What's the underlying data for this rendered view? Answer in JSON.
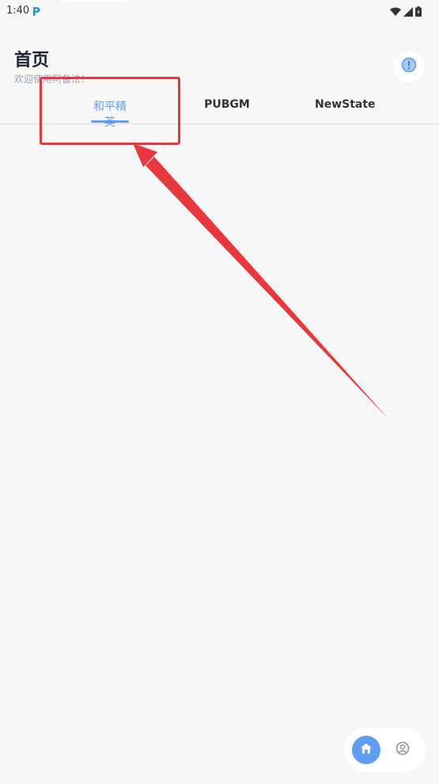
{
  "status_bar": {
    "time": "1:40",
    "icons": [
      "app-notification-icon",
      "wifi-icon",
      "signal-icon",
      "battery-icon"
    ]
  },
  "header": {
    "title": "首页",
    "subtitle": "欢迎使用阿备法！",
    "info_icon": "info-icon"
  },
  "tabs": [
    {
      "label": "和平精英",
      "active": true
    },
    {
      "label": "PUBGM",
      "active": false
    },
    {
      "label": "NewState",
      "active": false
    }
  ],
  "bottom_nav": {
    "items": [
      {
        "name": "home",
        "icon": "home-icon",
        "active": true
      },
      {
        "name": "profile",
        "icon": "profile-icon",
        "active": false
      }
    ]
  },
  "colors": {
    "accent": "#5f9df4",
    "annotation": "#e8383d",
    "background": "#f7f7f7"
  }
}
